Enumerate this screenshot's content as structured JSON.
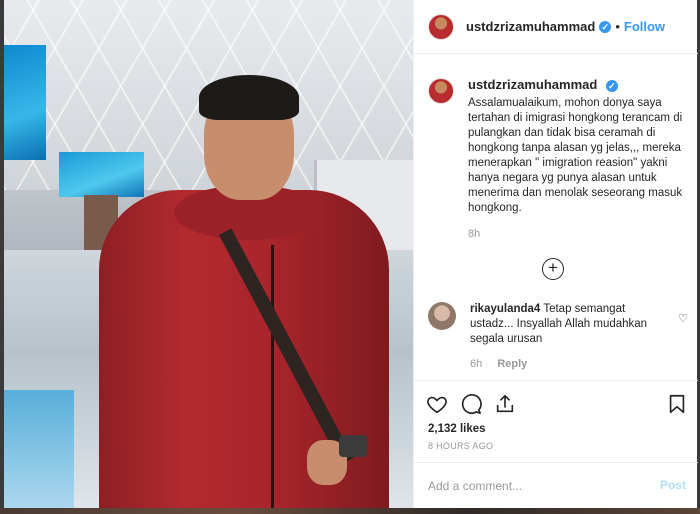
{
  "post": {
    "username": "ustdzrizamuhammad",
    "verified_badge": "✓",
    "follow_separator": "•",
    "follow_label": "Follow",
    "caption": "Assalamualaikum, mohon donya saya tertahan di imigrasi hongkong terancam di pulangkan dan tidak bisa ceramah di hongkong tanpa alasan yg jelas,,, mereka menerapkan \" imigration reasion\" yakni hanya negara yg punya alasan untuk menerima dan menolak seseorang masuk hongkong.",
    "caption_age": "8h",
    "add_icon_glyph": "+"
  },
  "comment": {
    "username": "rikayulanda4",
    "text": "Tetap semangat ustadz... Insyallah Allah mudahkan segala urusan",
    "age": "6h",
    "reply_label": "Reply",
    "heart_glyph": "♡"
  },
  "actions": {
    "likes": "2,132 likes",
    "timestamp": "8 HOURS AGO",
    "icons": [
      "heart-icon",
      "comment-icon",
      "share-icon",
      "bookmark-icon"
    ]
  },
  "comment_box": {
    "placeholder": "Add a comment...",
    "post_label": "Post"
  },
  "colors": {
    "accent": "#3897f0",
    "muted": "#999999",
    "post_disabled": "#b2dffc"
  }
}
